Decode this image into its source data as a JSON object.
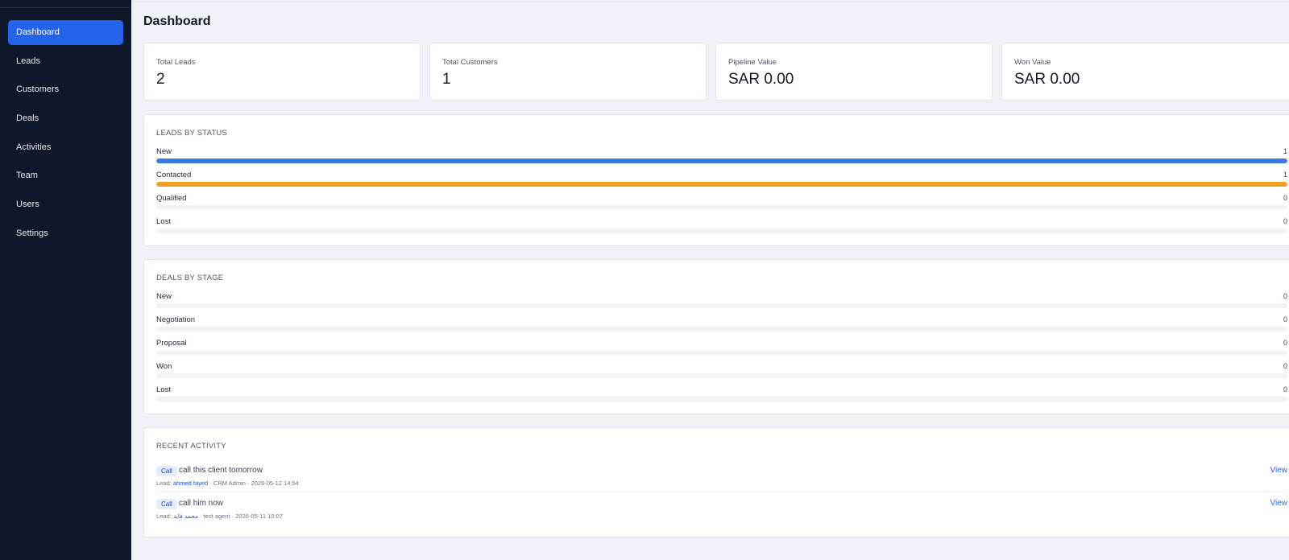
{
  "sidebar": {
    "items": [
      {
        "label": "Dashboard",
        "active": true
      },
      {
        "label": "Leads"
      },
      {
        "label": "Customers"
      },
      {
        "label": "Deals"
      },
      {
        "label": "Activities"
      },
      {
        "label": "Team"
      },
      {
        "label": "Users"
      },
      {
        "label": "Settings"
      }
    ]
  },
  "header": {
    "title": "Dashboard"
  },
  "stats": [
    {
      "label": "Total Leads",
      "value": "2"
    },
    {
      "label": "Total Customers",
      "value": "1"
    },
    {
      "label": "Pipeline Value",
      "value": "SAR 0.00"
    },
    {
      "label": "Won Value",
      "value": "SAR 0.00"
    }
  ],
  "leads_by_status": {
    "title": "LEADS BY STATUS",
    "rows": [
      {
        "label": "New",
        "count": "1",
        "fraction": 1.0,
        "color": "#3b7be0"
      },
      {
        "label": "Contacted",
        "count": "1",
        "fraction": 1.0,
        "color": "#f0a21f"
      },
      {
        "label": "Qualified",
        "count": "0",
        "fraction": 0.0,
        "color": "#10b981"
      },
      {
        "label": "Lost",
        "count": "0",
        "fraction": 0.0,
        "color": "#ef4444"
      }
    ]
  },
  "deals_by_stage": {
    "title": "DEALS BY STAGE",
    "rows": [
      {
        "label": "New",
        "count": "0",
        "fraction": 0.0
      },
      {
        "label": "Negotiation",
        "count": "0",
        "fraction": 0.0
      },
      {
        "label": "Proposal",
        "count": "0",
        "fraction": 0.0
      },
      {
        "label": "Won",
        "count": "0",
        "fraction": 0.0
      },
      {
        "label": "Lost",
        "count": "0",
        "fraction": 0.0
      }
    ]
  },
  "recent_activity": {
    "title": "RECENT ACTIVITY",
    "items": [
      {
        "type": "Call",
        "text": "call this client tomorrow",
        "lead_prefix": "Lead: ",
        "lead_name": "ahmed fayed",
        "meta_rest": " · CRM Admin · 2026-05-12 14:54",
        "view": "View"
      },
      {
        "type": "Call",
        "text": "call him now",
        "lead_prefix": "Lead: ",
        "lead_name": "محمد فايد",
        "meta_rest": " · test agent · 2026-05-11 10:07",
        "view": "View"
      }
    ]
  },
  "colors": {
    "sidebar_bg": "#0f172a",
    "accent": "#2563eb",
    "page_bg": "#eff3f8"
  }
}
